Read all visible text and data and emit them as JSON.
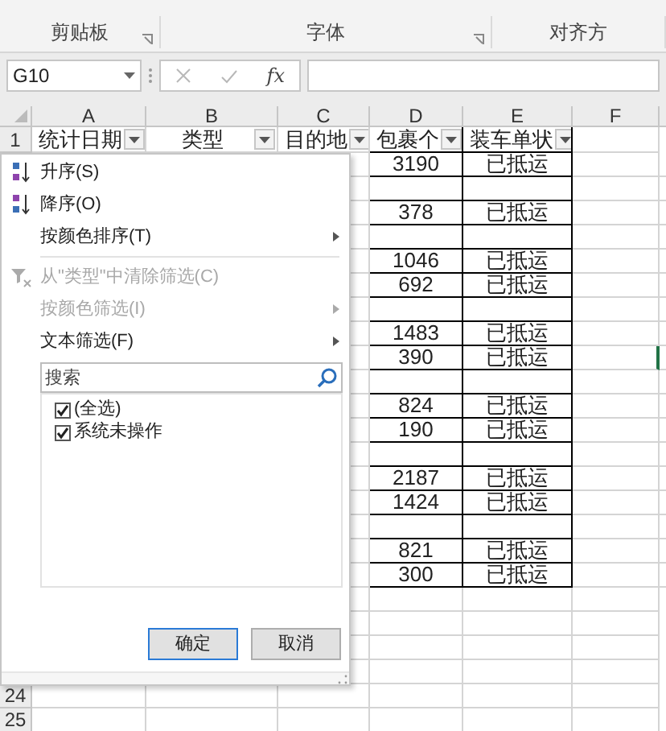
{
  "ribbon": {
    "groups": [
      {
        "label": "剪贴板",
        "launcher": true
      },
      {
        "label": "字体",
        "launcher": true
      },
      {
        "label": "对齐方",
        "launcher": false
      }
    ]
  },
  "formula_bar": {
    "name_box": "G10",
    "fx": "fx"
  },
  "column_headers": [
    "A",
    "B",
    "C",
    "D",
    "E",
    "F"
  ],
  "header_row": {
    "number": "1",
    "cells": [
      "统计日期",
      "类型",
      "目的地",
      "包裹个",
      "装车单状"
    ]
  },
  "table_rows": [
    {
      "package_count": "3190",
      "status": "已抵运"
    },
    {},
    {
      "package_count": "378",
      "status": "已抵运"
    },
    {},
    {
      "package_count": "1046",
      "status": "已抵运"
    },
    {
      "package_count": "692",
      "status": "已抵运"
    },
    {},
    {
      "package_count": "1483",
      "status": "已抵运"
    },
    {
      "package_count": "390",
      "status": "已抵运"
    },
    {},
    {
      "package_count": "824",
      "status": "已抵运"
    },
    {
      "package_count": "190",
      "status": "已抵运"
    },
    {},
    {
      "package_count": "2187",
      "status": "已抵运"
    },
    {
      "package_count": "1424",
      "status": "已抵运"
    },
    {},
    {
      "package_count": "821",
      "status": "已抵运"
    },
    {
      "package_count": "300",
      "status": "已抵运"
    }
  ],
  "extra_rows": [
    {
      "number": "24"
    },
    {
      "number": "25"
    }
  ],
  "filter_menu": {
    "items": [
      {
        "kind": "sort-asc",
        "label": "升序(S)",
        "disabled": false,
        "submenu": false
      },
      {
        "kind": "sort-desc",
        "label": "降序(O)",
        "disabled": false,
        "submenu": false
      },
      {
        "kind": "plain",
        "label": "按颜色排序(T)",
        "disabled": false,
        "submenu": true
      },
      {
        "kind": "clear-filter",
        "label": "从\"类型\"中清除筛选(C)",
        "disabled": true,
        "submenu": false
      },
      {
        "kind": "plain",
        "label": "按颜色筛选(I)",
        "disabled": true,
        "submenu": true
      },
      {
        "kind": "plain",
        "label": "文本筛选(F)",
        "disabled": false,
        "submenu": true
      }
    ],
    "search": {
      "placeholder": "搜索"
    },
    "values": [
      {
        "label": "(全选)",
        "checked": true
      },
      {
        "label": "系统未操作",
        "checked": true
      }
    ],
    "buttons": [
      {
        "label": "确定",
        "selected": true
      },
      {
        "label": "取消",
        "selected": false
      }
    ]
  }
}
